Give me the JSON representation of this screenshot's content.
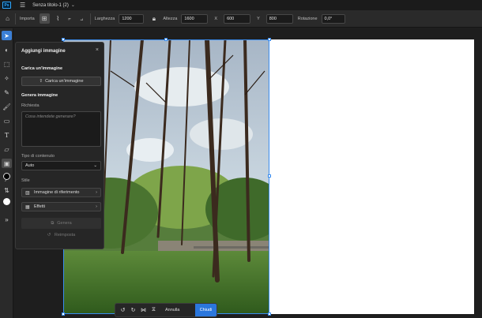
{
  "titlebar": {
    "logo": "Ps",
    "doc_title": "Senza titolo-1 (2)"
  },
  "options": {
    "importa": "Importa",
    "width_label": "Larghezza",
    "width_value": "1200",
    "height_label": "Altezza",
    "height_value": "1600",
    "x_label": "X",
    "x_value": "600",
    "y_label": "Y",
    "y_value": "800",
    "rotation_label": "Rotazione",
    "rotation_value": "0,0°"
  },
  "panel": {
    "title": "Aggiungi immagine",
    "upload_section": "Carica un'immagine",
    "upload_button": "Carica un'immagine",
    "generate_section": "Genera immagine",
    "prompt_label": "Richiesta",
    "prompt_placeholder": "Cosa intendete generare?",
    "content_type_label": "Tipo di contenuto",
    "content_type_value": "Auto",
    "style_label": "Stile",
    "reference_image": "Immagine di riferimento",
    "effects": "Effetti",
    "generate_button": "Genera",
    "reset_button": "Reimposta"
  },
  "actions": {
    "cancel": "Annulla",
    "close": "Chiudi"
  },
  "colors": {
    "accent": "#2b77dd",
    "selection": "#3a8df0"
  }
}
